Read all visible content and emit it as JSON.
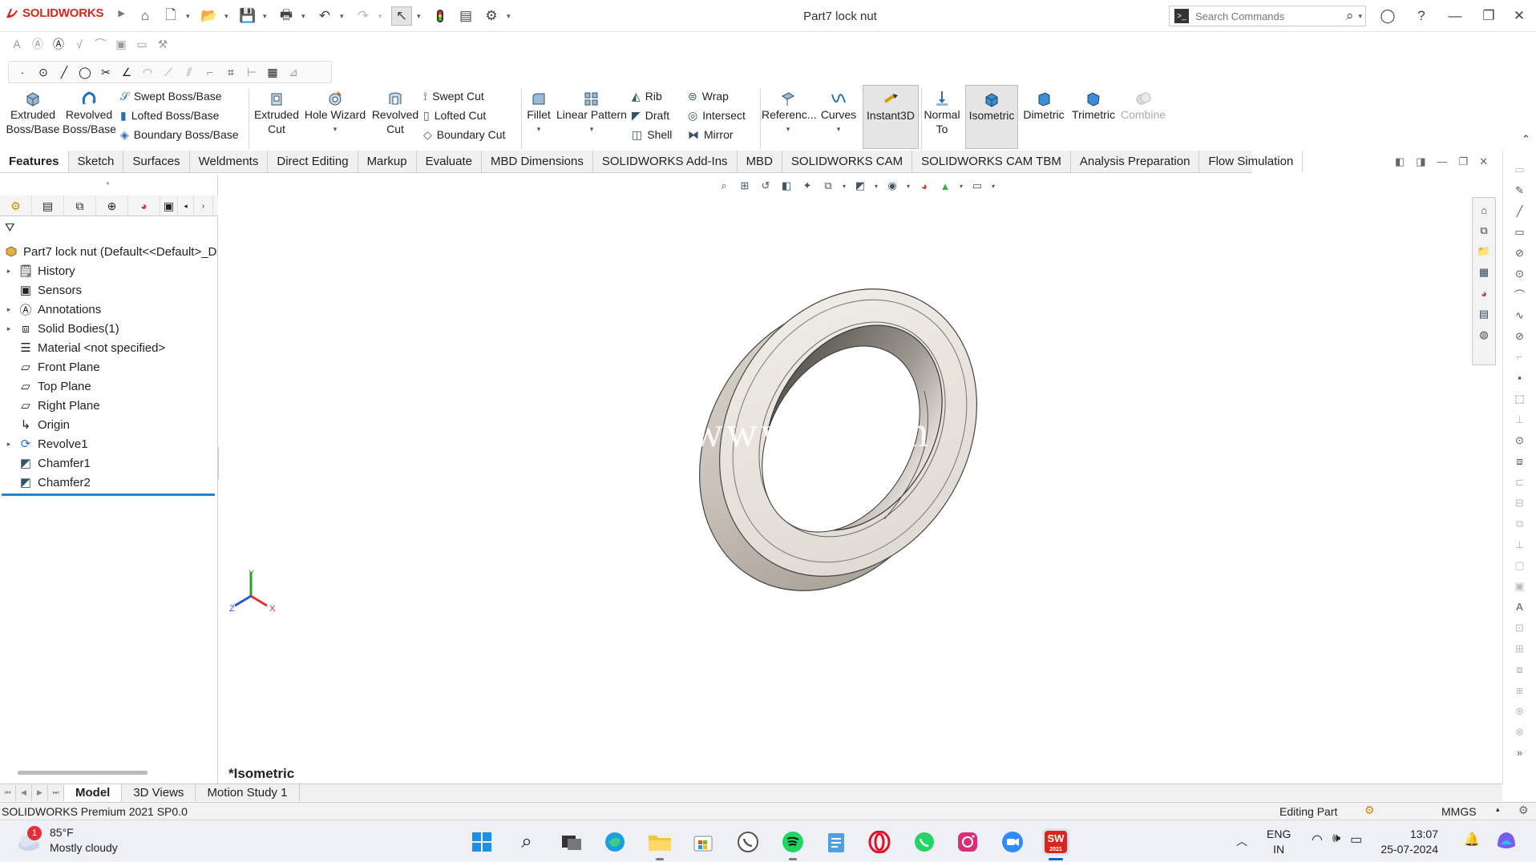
{
  "app": {
    "logo": "SOLIDWORKS",
    "document_title": "Part7 lock nut"
  },
  "search": {
    "placeholder": "Search Commands"
  },
  "commands": {
    "extruded_boss": "Extruded Boss/Base",
    "revolved_boss": "Revolved Boss/Base",
    "swept_boss": "Swept Boss/Base",
    "lofted_boss": "Lofted Boss/Base",
    "boundary_boss": "Boundary Boss/Base",
    "extruded_cut": "Extruded Cut",
    "hole_wizard": "Hole Wizard",
    "revolved_cut": "Revolved Cut",
    "swept_cut": "Swept Cut",
    "lofted_cut": "Lofted Cut",
    "boundary_cut": "Boundary Cut",
    "fillet": "Fillet",
    "linear_pattern": "Linear Pattern",
    "rib": "Rib",
    "draft": "Draft",
    "shell": "Shell",
    "wrap": "Wrap",
    "intersect": "Intersect",
    "mirror": "Mirror",
    "reference": "Referenc...",
    "curves": "Curves",
    "instant3d": "Instant3D",
    "normal_to": "Normal To",
    "isometric": "Isometric",
    "dimetric": "Dimetric",
    "trimetric": "Trimetric",
    "combine": "Combine"
  },
  "tabs": [
    "Features",
    "Sketch",
    "Surfaces",
    "Weldments",
    "Direct Editing",
    "Markup",
    "Evaluate",
    "MBD Dimensions",
    "SOLIDWORKS Add-Ins",
    "MBD",
    "SOLIDWORKS CAM",
    "SOLIDWORKS CAM TBM",
    "Analysis Preparation",
    "Flow Simulation"
  ],
  "tree": {
    "root": "Part7 lock nut  (Default<<Default>_D",
    "items": [
      "History",
      "Sensors",
      "Annotations",
      "Solid Bodies(1)",
      "Material <not specified>",
      "Front Plane",
      "Top Plane",
      "Right Plane",
      "Origin",
      "Revolve1",
      "Chamfer1",
      "Chamfer2"
    ]
  },
  "viewport": {
    "view_label": "*Isometric",
    "watermark": "www.3 .con",
    "axis_x": "X",
    "axis_y": "Y",
    "axis_z": "Z"
  },
  "bottom_tabs": [
    "Model",
    "3D Views",
    "Motion Study 1"
  ],
  "status": {
    "version": "SOLIDWORKS Premium 2021 SP0.0",
    "mode": "Editing Part",
    "units": "MMGS"
  },
  "taskbar": {
    "temperature": "85°F",
    "weather": "Mostly cloudy",
    "weather_badge": "1",
    "lang1": "ENG",
    "lang2": "IN",
    "time": "13:07",
    "date": "25-07-2024",
    "sw_badge": "2021"
  },
  "colors": {
    "brand": "#d9261c",
    "part": "#e6e1d8",
    "tab_active": "#ffffff"
  }
}
